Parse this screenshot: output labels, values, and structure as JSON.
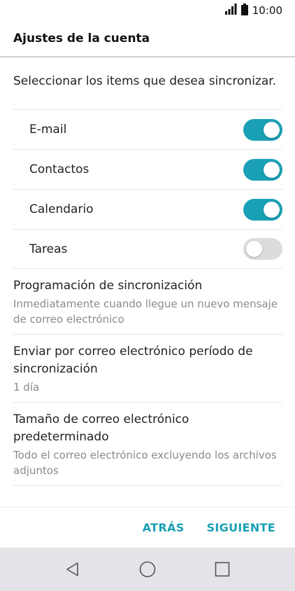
{
  "status_bar": {
    "time": "10:00"
  },
  "header": {
    "title": "Ajustes de la cuenta"
  },
  "intro": "Seleccionar los items que desea sincronizar.",
  "sync_items": [
    {
      "label": "E-mail",
      "enabled": true
    },
    {
      "label": "Contactos",
      "enabled": true
    },
    {
      "label": "Calendario",
      "enabled": true
    },
    {
      "label": "Tareas",
      "enabled": false
    }
  ],
  "settings": [
    {
      "title": "Programación de sincronización",
      "subtitle": "Inmediatamente cuando llegue un nuevo mensaje de correo electrónico"
    },
    {
      "title": "Enviar por correo electrónico período de sincronización",
      "subtitle": "1 día"
    },
    {
      "title": "Tamaño de correo electrónico predeterminado",
      "subtitle": "Todo el correo electrónico excluyendo los archivos adjuntos"
    }
  ],
  "footer": {
    "back_label": "ATRÁS",
    "next_label": "SIGUIENTE"
  },
  "colors": {
    "accent": "#1aa0b4",
    "toggle_off": "#dcdcdc",
    "navbar_bg": "#e4e4e8"
  }
}
